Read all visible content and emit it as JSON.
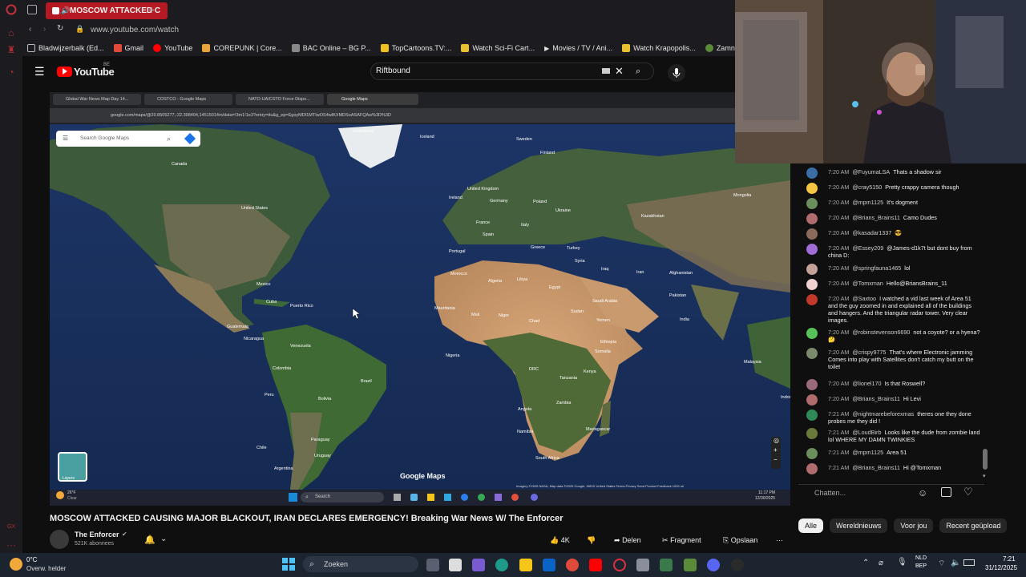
{
  "browser": {
    "active_tab": "MOSCOW ATTACKED C",
    "url": "www.youtube.com/watch",
    "bookmarks": [
      "Bladwijzerbalk (Ed...",
      "Gmail",
      "YouTube",
      "COREPUNK | Core...",
      "BAC Online – BG P...",
      "TopCartoons.TV:...",
      "Watch Sci-Fi Cart...",
      "Movies / TV / Ani...",
      "Watch Krapopolis...",
      "Zamnesia"
    ]
  },
  "youtube": {
    "logo": "YouTube",
    "logo_country": "BE",
    "search_query": "Riftbound",
    "video_title": "MOSCOW ATTACKED CAUSING MAJOR BLACKOUT, IRAN DECLARES EMERGENCY! Breaking War News W/ The Enforcer",
    "channel_name": "The Enforcer",
    "subscribers": "521K abonnees",
    "likes": "4K",
    "share_label": "Delen",
    "clip_label": "Fragment",
    "save_label": "Opslaan"
  },
  "inner_browser": {
    "tabs": [
      "Global War News Map Day 14...",
      "COSTCO - Google Maps",
      "NATO-UA/CSTO Force Dispo...",
      "Google Maps"
    ],
    "url": "google.com/maps/@20.8505277,-22.398404,14515014m/data=!3m1!1e3?entry=ttu&g_ep=EgoyMDI1MTIwOS4wIKXMDSoASAFQAw%3D%3D"
  },
  "map": {
    "search_placeholder": "Search Google Maps",
    "watermark": "Google Maps",
    "layers_label": "Layers",
    "footer": "Imagery ©2025 NASA, Map data ©2025 Google, INEGI   United States   Terms   Privacy   Send Product Feedback   1000 mi",
    "labels": [
      {
        "t": "Greenland"
      },
      {
        "t": "Iceland"
      },
      {
        "t": "Sweden"
      },
      {
        "t": "Finland"
      },
      {
        "t": "Canada"
      },
      {
        "t": "United Kingdom"
      },
      {
        "t": "Ireland"
      },
      {
        "t": "Germany"
      },
      {
        "t": "Poland"
      },
      {
        "t": "Ukraine"
      },
      {
        "t": "Kazakhstan"
      },
      {
        "t": "France"
      },
      {
        "t": "Italy"
      },
      {
        "t": "Spain"
      },
      {
        "t": "Portugal"
      },
      {
        "t": "Greece"
      },
      {
        "t": "Turkey"
      },
      {
        "t": "Syria"
      },
      {
        "t": "Iraq"
      },
      {
        "t": "Iran"
      },
      {
        "t": "Afghanistan"
      },
      {
        "t": "Pakistan"
      },
      {
        "t": "United States"
      },
      {
        "t": "Morocco"
      },
      {
        "t": "Algeria"
      },
      {
        "t": "Libya"
      },
      {
        "t": "Egypt"
      },
      {
        "t": "Saudi Arabia"
      },
      {
        "t": "Mauritania"
      },
      {
        "t": "Mali"
      },
      {
        "t": "Niger"
      },
      {
        "t": "Chad"
      },
      {
        "t": "Sudan"
      },
      {
        "t": "Mexico"
      },
      {
        "t": "Cuba"
      },
      {
        "t": "Puerto Rico"
      },
      {
        "t": "Guatemala"
      },
      {
        "t": "Nicaragua"
      },
      {
        "t": "Venezuela"
      },
      {
        "t": "Colombia"
      },
      {
        "t": "Nigeria"
      },
      {
        "t": "Ethiopia"
      },
      {
        "t": "Somalia"
      },
      {
        "t": "Kenya"
      },
      {
        "t": "DRC"
      },
      {
        "t": "Tanzania"
      },
      {
        "t": "Brazil"
      },
      {
        "t": "Peru"
      },
      {
        "t": "Bolivia"
      },
      {
        "t": "Angola"
      },
      {
        "t": "Zambia"
      },
      {
        "t": "Namibia"
      },
      {
        "t": "Madagascar"
      },
      {
        "t": "South Africa"
      },
      {
        "t": "Paraguay"
      },
      {
        "t": "Uruguay"
      },
      {
        "t": "Chile"
      },
      {
        "t": "Argentina"
      },
      {
        "t": "India"
      },
      {
        "t": "Yemen"
      },
      {
        "t": "Malaysia"
      },
      {
        "t": "Indonesia"
      },
      {
        "t": "Mongolia"
      }
    ]
  },
  "inner_taskbar": {
    "weather_temp": "26°F",
    "weather_cond": "Clear",
    "search": "Search",
    "time": "11:17 PM",
    "date": "12/30/2025"
  },
  "chat": {
    "messages": [
      {
        "time": "7:20 AM",
        "author": "@FuyumaLSA",
        "text": "Thats a shadow sir",
        "color": "#3a6ea5"
      },
      {
        "time": "7:20 AM",
        "author": "@cray5150",
        "text": "Pretty crappy camera though",
        "color": "#f4c542"
      },
      {
        "time": "7:20 AM",
        "author": "@mpm1125",
        "text": "It's dogment",
        "color": "#6b8f5a"
      },
      {
        "time": "7:20 AM",
        "author": "@Brians_Brains11",
        "text": "Camo Dudes",
        "color": "#b06c6c"
      },
      {
        "time": "7:20 AM",
        "author": "@kasadar1337",
        "text": "😎",
        "color": "#8a6a5a"
      },
      {
        "time": "7:20 AM",
        "author": "@Essey209",
        "text": "@James-d1k7t but dont buy from china D:",
        "color": "#a06cd5"
      },
      {
        "time": "7:20 AM",
        "author": "@springfauna1465",
        "text": "lol",
        "color": "#c4a29a"
      },
      {
        "time": "7:20 AM",
        "author": "@Tomxman",
        "text": "Hello@BriansBrains_11",
        "color": "#f0d0d0"
      },
      {
        "time": "7:20 AM",
        "author": "@Saxtoo",
        "text": "I watched a vid last week of Area 51 and the guy zoomed in and explained all of the buildings and hangers. And the triangular radar tower. Very clear images.",
        "color": "#c0392b"
      },
      {
        "time": "7:20 AM",
        "author": "@robinstevenson6690",
        "text": "not a coyote? or a hyena? 🤔",
        "color": "#58c25a"
      },
      {
        "time": "7:20 AM",
        "author": "@crispy9775",
        "text": "That's where Electronic jamming Comes into play with Satellites don't catch my butt on the toilet",
        "color": "#7a8a6a"
      },
      {
        "time": "7:20 AM",
        "author": "@lionel170",
        "text": "Is that Roswell?",
        "color": "#9a6a7a"
      },
      {
        "time": "7:20 AM",
        "author": "@Brians_Brains11",
        "text": "Hi Levi",
        "color": "#b06c6c"
      },
      {
        "time": "7:21 AM",
        "author": "@nightmarebeforexmas",
        "text": "theres one they done probes me they did !",
        "color": "#2e8b57"
      },
      {
        "time": "7:21 AM",
        "author": "@LoudBirb",
        "text": "Looks like the dude from zombie land lol WHERE MY DAMN TWINKIES",
        "color": "#6a7a3a"
      },
      {
        "time": "7:21 AM",
        "author": "@mpm1125",
        "text": "Area 51",
        "color": "#6b8f5a"
      },
      {
        "time": "7:21 AM",
        "author": "@Brians_Brains11",
        "text": "Hi @Tomxman",
        "color": "#b06c6c"
      }
    ],
    "input_placeholder": "Chatten...",
    "chips": [
      "Alle",
      "Wereldnieuws",
      "Voor jou",
      "Recent geüpload"
    ]
  },
  "win_taskbar": {
    "temp": "0°C",
    "weather": "Overw. helder",
    "search": "Zoeken",
    "lang1": "NLD",
    "lang2": "BEP",
    "time": "7:21",
    "date": "31/12/2025"
  }
}
